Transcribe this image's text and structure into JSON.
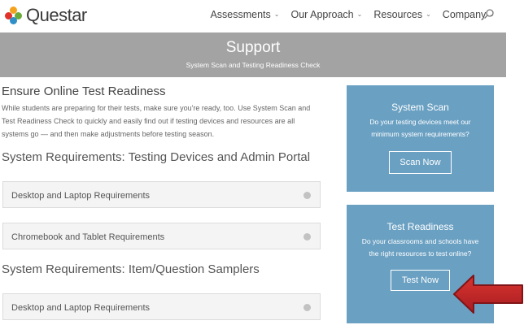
{
  "header": {
    "logo_text": "Questar",
    "nav": [
      {
        "label": "Assessments"
      },
      {
        "label": "Our Approach"
      },
      {
        "label": "Resources"
      },
      {
        "label": "Company"
      }
    ],
    "chevron": "⌄"
  },
  "banner": {
    "title": "Support",
    "subtitle": "System Scan and Testing Readiness Check"
  },
  "main": {
    "heading": "Ensure Online Test Readiness",
    "intro": "While students are preparing for their tests, make sure you're ready, too. Use System Scan and Test Readiness Check to quickly and easily find out if testing devices and resources are all systems go — and then make adjustments before testing season.",
    "section1": "System Requirements: Testing Devices and Admin Portal",
    "section2": "System Requirements: Item/Question Samplers",
    "accordions": [
      {
        "label": "Desktop and Laptop Requirements"
      },
      {
        "label": "Chromebook and Tablet Requirements"
      },
      {
        "label": "Desktop and Laptop Requirements"
      }
    ]
  },
  "cards": {
    "scan": {
      "title": "System Scan",
      "text": "Do your testing devices meet our minimum system requirements?",
      "button": "Scan Now"
    },
    "readiness": {
      "title": "Test Readiness",
      "text": "Do your classrooms and schools have the right resources to test online?",
      "button": "Test Now"
    }
  },
  "colors": {
    "card_bg": "#6aa0c2",
    "banner_bg": "#a3a3a3",
    "arrow": "#c0272d"
  }
}
